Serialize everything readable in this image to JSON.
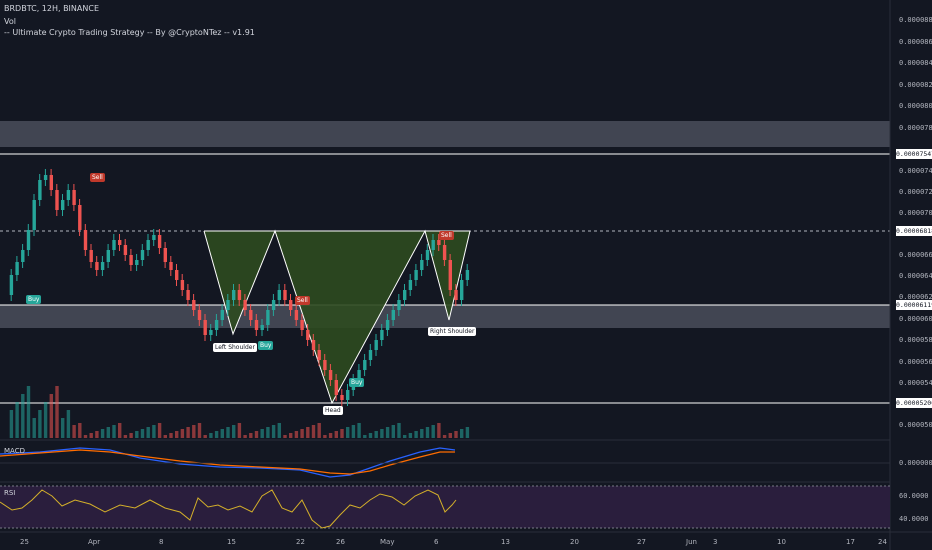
{
  "header": {
    "symbol_line": "BRDBTC, 12H, BINANCE",
    "volume_label": "Vol",
    "strategy_line": "-- Ultimate Crypto Trading Strategy -- By @CryptoNTez -- v1.91"
  },
  "price_axis": {
    "ticks": [
      "0.00008800",
      "0.00008600",
      "0.00008400",
      "0.00008200",
      "0.00008000",
      "0.00007800",
      "0.00007400",
      "0.00007200",
      "0.00007000",
      "0.00006600",
      "0.00006400",
      "0.00006200",
      "0.00006000",
      "0.00005800",
      "0.00005600",
      "0.00005400",
      "0.00005000"
    ],
    "highlighted": [
      "0.00007547",
      "0.00006818",
      "0.00006119",
      "0.00005200"
    ]
  },
  "date_axis": [
    "25",
    "Apr",
    "8",
    "15",
    "22",
    "26",
    "May",
    "6",
    "13",
    "20",
    "27",
    "Jun",
    "3",
    "10",
    "17",
    "24"
  ],
  "annotations": {
    "left_shoulder": "Left Shoulder",
    "head": "Head",
    "right_shoulder": "Right Shoulder",
    "buy": "Buy",
    "sell": "Sell"
  },
  "macd": {
    "label": "MACD",
    "tick": "0.00000000"
  },
  "rsi": {
    "label": "RSI",
    "ticks": [
      "60.0000",
      "40.0000"
    ]
  },
  "colors": {
    "background": "#131722",
    "bull": "#26a69a",
    "bear": "#ef5350",
    "pattern_fill": "#1e3a1e",
    "rsi_band": "#2a1e3d",
    "rsi_line": "#d4b02a",
    "macd_line": "#2962ff",
    "signal_line": "#ff6d00"
  }
}
